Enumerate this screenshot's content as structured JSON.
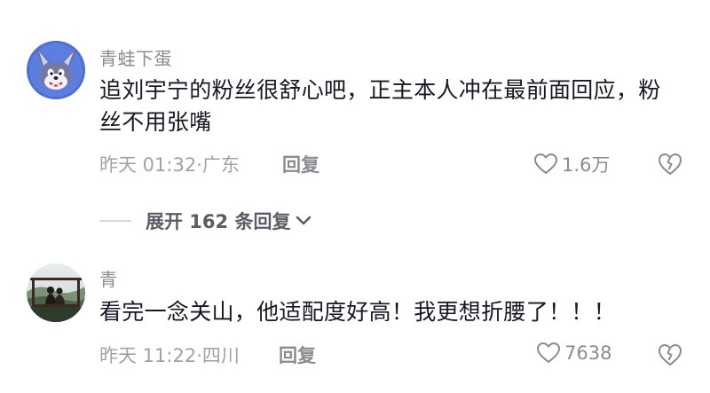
{
  "comments": [
    {
      "username": "青蛙下蛋",
      "text": "追刘宇宁的粉丝很舒心吧，正主本人冲在最前面回应，粉丝不用张嘴",
      "time": "昨天 01:32·广东",
      "reply_label": "回复",
      "likes": "1.6万",
      "avatar_icon": "cartoon-rabbit-avatar"
    },
    {
      "username": "青",
      "text": "看完一念关山，他适配度好高！我更想折腰了！！！",
      "time": "昨天 11:22·四川",
      "reply_label": "回复",
      "likes": "7638",
      "avatar_icon": "landscape-couple-avatar"
    }
  ],
  "expand_replies": {
    "label": "展开 162 条回复"
  },
  "icons": {
    "like": "heart-outline-icon",
    "dislike": "broken-heart-icon",
    "expand": "chevron-down-icon"
  }
}
